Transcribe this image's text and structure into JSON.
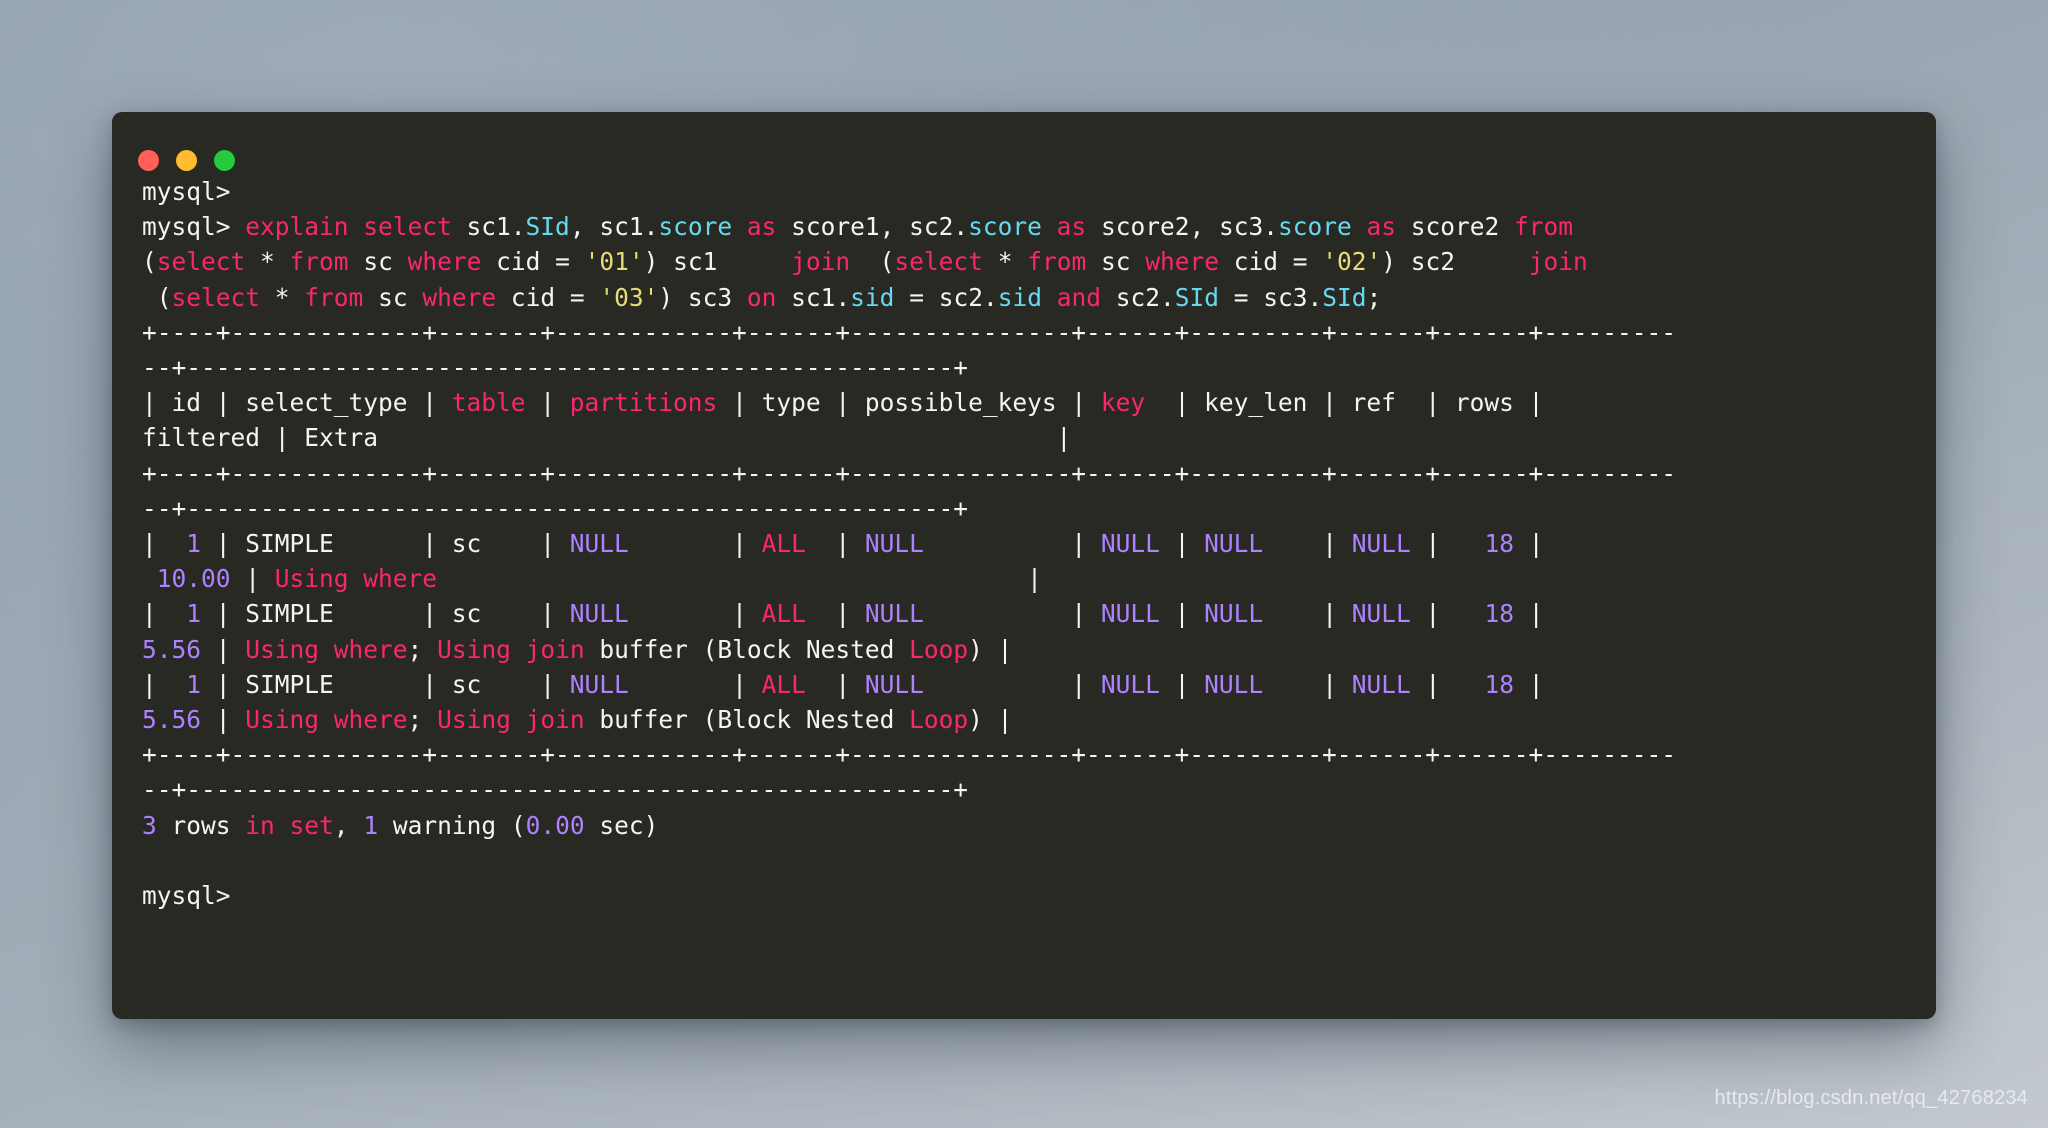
{
  "window": {
    "title": "",
    "traffic_lights": [
      {
        "name": "close",
        "color": "#ff5f56"
      },
      {
        "name": "minimize",
        "color": "#ffbd2e"
      },
      {
        "name": "maximize",
        "color": "#27c93f"
      }
    ],
    "background_color": "#282923"
  },
  "theme": {
    "keyword": "#f92672",
    "column": "#66d9ef",
    "string": "#e6db74",
    "number": "#ae81ff",
    "text": "#f5f5f0",
    "background": "#282923"
  },
  "watermark": "https://blog.csdn.net/qq_42768234",
  "terminal": {
    "prompt": "mysql>",
    "lines": [
      {
        "id": "line-prompt-1",
        "spans": [
          {
            "t": "mysql>",
            "c": "plain"
          }
        ]
      },
      {
        "id": "line-query-1",
        "spans": [
          {
            "t": "mysql> ",
            "c": "plain"
          },
          {
            "t": "explain select ",
            "c": "kw"
          },
          {
            "t": "sc1.",
            "c": "plain"
          },
          {
            "t": "SId",
            "c": "col"
          },
          {
            "t": ", sc1.",
            "c": "plain"
          },
          {
            "t": "score",
            "c": "col"
          },
          {
            "t": " ",
            "c": "plain"
          },
          {
            "t": "as",
            "c": "kw"
          },
          {
            "t": " score1, sc2.",
            "c": "plain"
          },
          {
            "t": "score",
            "c": "col"
          },
          {
            "t": " ",
            "c": "plain"
          },
          {
            "t": "as",
            "c": "kw"
          },
          {
            "t": " score2, sc3.",
            "c": "plain"
          },
          {
            "t": "score",
            "c": "col"
          },
          {
            "t": " ",
            "c": "plain"
          },
          {
            "t": "as",
            "c": "kw"
          },
          {
            "t": " score2 ",
            "c": "plain"
          },
          {
            "t": "from",
            "c": "kw"
          }
        ]
      },
      {
        "id": "line-query-2",
        "spans": [
          {
            "t": "(",
            "c": "plain"
          },
          {
            "t": "select",
            "c": "kw"
          },
          {
            "t": " * ",
            "c": "plain"
          },
          {
            "t": "from",
            "c": "kw"
          },
          {
            "t": " sc ",
            "c": "plain"
          },
          {
            "t": "where",
            "c": "kw"
          },
          {
            "t": " cid = ",
            "c": "plain"
          },
          {
            "t": "'01'",
            "c": "str"
          },
          {
            "t": ") sc1     ",
            "c": "plain"
          },
          {
            "t": "join",
            "c": "kw"
          },
          {
            "t": "  (",
            "c": "plain"
          },
          {
            "t": "select",
            "c": "kw"
          },
          {
            "t": " * ",
            "c": "plain"
          },
          {
            "t": "from",
            "c": "kw"
          },
          {
            "t": " sc ",
            "c": "plain"
          },
          {
            "t": "where",
            "c": "kw"
          },
          {
            "t": " cid = ",
            "c": "plain"
          },
          {
            "t": "'02'",
            "c": "str"
          },
          {
            "t": ") sc2     ",
            "c": "plain"
          },
          {
            "t": "join",
            "c": "kw"
          }
        ]
      },
      {
        "id": "line-query-3",
        "spans": [
          {
            "t": " (",
            "c": "plain"
          },
          {
            "t": "select",
            "c": "kw"
          },
          {
            "t": " * ",
            "c": "plain"
          },
          {
            "t": "from",
            "c": "kw"
          },
          {
            "t": " sc ",
            "c": "plain"
          },
          {
            "t": "where",
            "c": "kw"
          },
          {
            "t": " cid = ",
            "c": "plain"
          },
          {
            "t": "'03'",
            "c": "str"
          },
          {
            "t": ") sc3 ",
            "c": "plain"
          },
          {
            "t": "on",
            "c": "kw"
          },
          {
            "t": " sc1.",
            "c": "plain"
          },
          {
            "t": "sid",
            "c": "col"
          },
          {
            "t": " = sc2.",
            "c": "plain"
          },
          {
            "t": "sid",
            "c": "col"
          },
          {
            "t": " ",
            "c": "plain"
          },
          {
            "t": "and",
            "c": "kw"
          },
          {
            "t": " sc2.",
            "c": "plain"
          },
          {
            "t": "SId",
            "c": "col"
          },
          {
            "t": " = sc3.",
            "c": "plain"
          },
          {
            "t": "SId",
            "c": "col"
          },
          {
            "t": ";",
            "c": "plain"
          }
        ]
      },
      {
        "id": "line-rule-1a",
        "spans": [
          {
            "t": "+----+-------------+-------+------------+------+---------------+------+---------+------+------+---------",
            "c": "plain"
          }
        ]
      },
      {
        "id": "line-rule-1b",
        "spans": [
          {
            "t": "--+----------------------------------------------------+",
            "c": "plain"
          }
        ]
      },
      {
        "id": "line-header-a",
        "spans": [
          {
            "t": "| id | select_type | ",
            "c": "plain"
          },
          {
            "t": "table",
            "c": "kw"
          },
          {
            "t": " | ",
            "c": "plain"
          },
          {
            "t": "partitions",
            "c": "kw"
          },
          {
            "t": " | type | possible_keys | ",
            "c": "plain"
          },
          {
            "t": "key",
            "c": "kw"
          },
          {
            "t": "  | key_len | ref  | rows | ",
            "c": "plain"
          }
        ]
      },
      {
        "id": "line-header-b",
        "spans": [
          {
            "t": "filtered | Extra                                              |",
            "c": "plain"
          }
        ]
      },
      {
        "id": "line-rule-2a",
        "spans": [
          {
            "t": "+----+-------------+-------+------------+------+---------------+------+---------+------+------+---------",
            "c": "plain"
          }
        ]
      },
      {
        "id": "line-rule-2b",
        "spans": [
          {
            "t": "--+----------------------------------------------------+",
            "c": "plain"
          }
        ]
      },
      {
        "id": "line-row-1a",
        "spans": [
          {
            "t": "|  ",
            "c": "plain"
          },
          {
            "t": "1",
            "c": "num"
          },
          {
            "t": " | SIMPLE      | sc    | ",
            "c": "plain"
          },
          {
            "t": "NULL",
            "c": "num"
          },
          {
            "t": "       | ",
            "c": "plain"
          },
          {
            "t": "ALL",
            "c": "kw"
          },
          {
            "t": "  | ",
            "c": "plain"
          },
          {
            "t": "NULL",
            "c": "num"
          },
          {
            "t": "          | ",
            "c": "plain"
          },
          {
            "t": "NULL",
            "c": "num"
          },
          {
            "t": " | ",
            "c": "plain"
          },
          {
            "t": "NULL",
            "c": "num"
          },
          {
            "t": "    | ",
            "c": "plain"
          },
          {
            "t": "NULL",
            "c": "num"
          },
          {
            "t": " |   ",
            "c": "plain"
          },
          {
            "t": "18",
            "c": "num"
          },
          {
            "t": " |",
            "c": "plain"
          }
        ]
      },
      {
        "id": "line-row-1b",
        "spans": [
          {
            "t": " ",
            "c": "plain"
          },
          {
            "t": "10.00",
            "c": "num"
          },
          {
            "t": " | ",
            "c": "plain"
          },
          {
            "t": "Using where",
            "c": "kw"
          },
          {
            "t": "                                        |",
            "c": "plain"
          }
        ]
      },
      {
        "id": "line-row-2a",
        "spans": [
          {
            "t": "|  ",
            "c": "plain"
          },
          {
            "t": "1",
            "c": "num"
          },
          {
            "t": " | SIMPLE      | sc    | ",
            "c": "plain"
          },
          {
            "t": "NULL",
            "c": "num"
          },
          {
            "t": "       | ",
            "c": "plain"
          },
          {
            "t": "ALL",
            "c": "kw"
          },
          {
            "t": "  | ",
            "c": "plain"
          },
          {
            "t": "NULL",
            "c": "num"
          },
          {
            "t": "          | ",
            "c": "plain"
          },
          {
            "t": "NULL",
            "c": "num"
          },
          {
            "t": " | ",
            "c": "plain"
          },
          {
            "t": "NULL",
            "c": "num"
          },
          {
            "t": "    | ",
            "c": "plain"
          },
          {
            "t": "NULL",
            "c": "num"
          },
          {
            "t": " |   ",
            "c": "plain"
          },
          {
            "t": "18",
            "c": "num"
          },
          {
            "t": " |",
            "c": "plain"
          }
        ]
      },
      {
        "id": "line-row-2b",
        "spans": [
          {
            "t": "",
            "c": "plain"
          },
          {
            "t": "5.56",
            "c": "num"
          },
          {
            "t": " | ",
            "c": "plain"
          },
          {
            "t": "Using where",
            "c": "kw"
          },
          {
            "t": "; ",
            "c": "plain"
          },
          {
            "t": "Using join",
            "c": "kw"
          },
          {
            "t": " buffer (Block Nested ",
            "c": "plain"
          },
          {
            "t": "Loop",
            "c": "kw"
          },
          {
            "t": ") |",
            "c": "plain"
          }
        ]
      },
      {
        "id": "line-row-3a",
        "spans": [
          {
            "t": "|  ",
            "c": "plain"
          },
          {
            "t": "1",
            "c": "num"
          },
          {
            "t": " | SIMPLE      | sc    | ",
            "c": "plain"
          },
          {
            "t": "NULL",
            "c": "num"
          },
          {
            "t": "       | ",
            "c": "plain"
          },
          {
            "t": "ALL",
            "c": "kw"
          },
          {
            "t": "  | ",
            "c": "plain"
          },
          {
            "t": "NULL",
            "c": "num"
          },
          {
            "t": "          | ",
            "c": "plain"
          },
          {
            "t": "NULL",
            "c": "num"
          },
          {
            "t": " | ",
            "c": "plain"
          },
          {
            "t": "NULL",
            "c": "num"
          },
          {
            "t": "    | ",
            "c": "plain"
          },
          {
            "t": "NULL",
            "c": "num"
          },
          {
            "t": " |   ",
            "c": "plain"
          },
          {
            "t": "18",
            "c": "num"
          },
          {
            "t": " |",
            "c": "plain"
          }
        ]
      },
      {
        "id": "line-row-3b",
        "spans": [
          {
            "t": "",
            "c": "plain"
          },
          {
            "t": "5.56",
            "c": "num"
          },
          {
            "t": " | ",
            "c": "plain"
          },
          {
            "t": "Using where",
            "c": "kw"
          },
          {
            "t": "; ",
            "c": "plain"
          },
          {
            "t": "Using join",
            "c": "kw"
          },
          {
            "t": " buffer (Block Nested ",
            "c": "plain"
          },
          {
            "t": "Loop",
            "c": "kw"
          },
          {
            "t": ") |",
            "c": "plain"
          }
        ]
      },
      {
        "id": "line-rule-3a",
        "spans": [
          {
            "t": "+----+-------------+-------+------------+------+---------------+------+---------+------+------+---------",
            "c": "plain"
          }
        ]
      },
      {
        "id": "line-rule-3b",
        "spans": [
          {
            "t": "--+----------------------------------------------------+",
            "c": "plain"
          }
        ]
      },
      {
        "id": "line-status",
        "spans": [
          {
            "t": "3",
            "c": "num"
          },
          {
            "t": " rows ",
            "c": "plain"
          },
          {
            "t": "in set",
            "c": "kw"
          },
          {
            "t": ", ",
            "c": "plain"
          },
          {
            "t": "1",
            "c": "num"
          },
          {
            "t": " warning (",
            "c": "plain"
          },
          {
            "t": "0.00",
            "c": "num"
          },
          {
            "t": " sec)",
            "c": "plain"
          }
        ]
      },
      {
        "id": "line-blank-1",
        "spans": [
          {
            "t": " ",
            "c": "plain"
          }
        ]
      },
      {
        "id": "line-prompt-2",
        "spans": [
          {
            "t": "mysql>",
            "c": "plain"
          }
        ]
      }
    ]
  },
  "explain_table": {
    "columns": [
      "id",
      "select_type",
      "table",
      "partitions",
      "type",
      "possible_keys",
      "key",
      "key_len",
      "ref",
      "rows",
      "filtered",
      "Extra"
    ],
    "rows": [
      {
        "id": "1",
        "select_type": "SIMPLE",
        "table": "sc",
        "partitions": "NULL",
        "type": "ALL",
        "possible_keys": "NULL",
        "key": "NULL",
        "key_len": "NULL",
        "ref": "NULL",
        "rows": "18",
        "filtered": "10.00",
        "Extra": "Using where"
      },
      {
        "id": "1",
        "select_type": "SIMPLE",
        "table": "sc",
        "partitions": "NULL",
        "type": "ALL",
        "possible_keys": "NULL",
        "key": "NULL",
        "key_len": "NULL",
        "ref": "NULL",
        "rows": "18",
        "filtered": "5.56",
        "Extra": "Using where; Using join buffer (Block Nested Loop)"
      },
      {
        "id": "1",
        "select_type": "SIMPLE",
        "table": "sc",
        "partitions": "NULL",
        "type": "ALL",
        "possible_keys": "NULL",
        "key": "NULL",
        "key_len": "NULL",
        "ref": "NULL",
        "rows": "18",
        "filtered": "5.56",
        "Extra": "Using where; Using join buffer (Block Nested Loop)"
      }
    ],
    "summary": "3 rows in set, 1 warning (0.00 sec)"
  }
}
